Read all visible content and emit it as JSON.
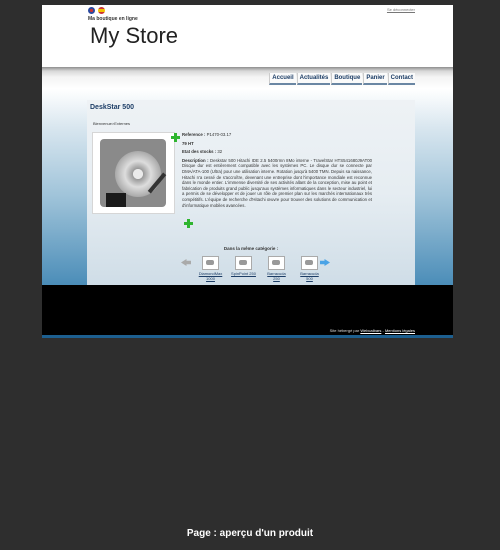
{
  "header": {
    "tagline": "Ma boutique en ligne",
    "store_title": "My Store",
    "logout": "Se déconnecter"
  },
  "nav": [
    "Accueil",
    "Actualités",
    "Boutique",
    "Panier",
    "Contact"
  ],
  "product": {
    "title": "DeskStar 500",
    "breadcrumb": "Bienvenue>Externes",
    "reference_label": "Reference :",
    "reference_value": "P1470-03.17",
    "price": "79 HT",
    "stock_label": "Etat des stocks :",
    "stock_value": "32",
    "description_label": "Description :",
    "description": "Deskstar 500 Hitachi IDE 2.5 5400rmn 8Mo interne - TravelStar HTS541680J9AT00 Disque dur est entièrement compatible avec les systèmes PC. Le disque dur se connecte par DMA/ATA-100 (Ultra) pour une utilisation interne. Rotation jusqu'à 5400 TMN. Depuis sa naissance, Hitachi n'a cessé de s'accroître, devenant une entreprise dont l'importance mondiale est reconnue dans le monde entier. L'immense diversité de ses activités allant de la conception, mise au point et fabrication de produits grand public jusqu'aux systèmes informatiques dans le secteur industriel, lui a permis de se développer et de jouer un rôle de premier plan sur les marchés internationaux très compétitifs. L'équipe de recherche d'Hitachi œuvre pour trouver des solutions de communication et d'informatique mobiles avancées."
  },
  "related": {
    "title": "Dans la même catégorie :",
    "items": [
      {
        "label": "DiamondMax 1000"
      },
      {
        "label": "SpinPoint 250"
      },
      {
        "label": "Barracuda 250"
      },
      {
        "label": "Barracuda 500"
      }
    ]
  },
  "footer": {
    "text": "Site hébergé par",
    "host_link": "Webcalbars",
    "separator": "-",
    "legal_link": "Mentions légales"
  },
  "caption": "Page : aperçu d'un produit"
}
